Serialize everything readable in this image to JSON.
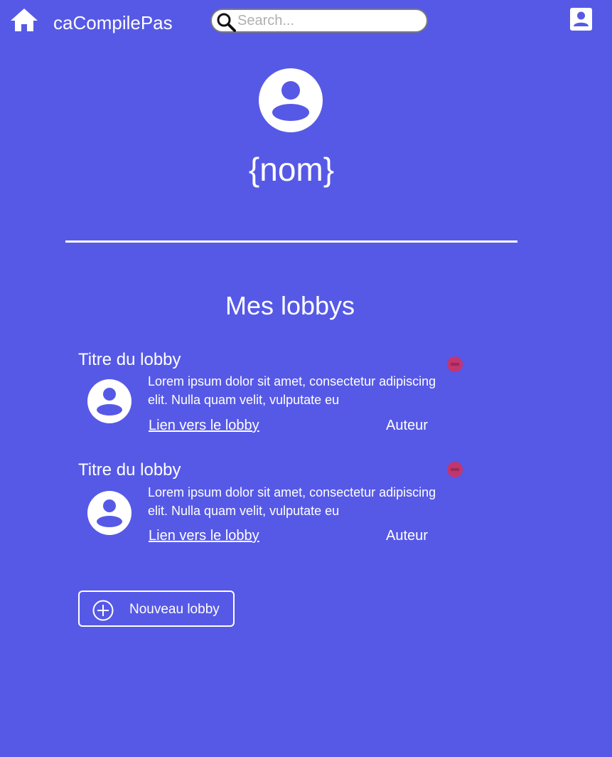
{
  "header": {
    "home_icon": "home-icon",
    "brand": "caCompilePas",
    "search_placeholder": "Search...",
    "search_icon": "search-icon",
    "account_icon": "account-box-icon"
  },
  "profile": {
    "avatar_icon": "account-circle-icon",
    "name": "{nom}"
  },
  "lobbies_section": {
    "title": "Mes lobbys",
    "items": [
      {
        "title": "Titre du lobby",
        "description": "Lorem ipsum dolor sit amet, consectetur adipiscing elit. Nulla quam velit, vulputate eu",
        "link": "Lien vers le lobby",
        "author": "Auteur",
        "remove_icon": "minus-circle-icon"
      },
      {
        "title": "Titre du lobby",
        "description": "Lorem ipsum dolor sit amet, consectetur adipiscing elit. Nulla quam velit, vulputate eu",
        "link": "Lien vers le lobby",
        "author": "Auteur",
        "remove_icon": "minus-circle-icon"
      }
    ],
    "new_button": {
      "label": "Nouveau lobby",
      "icon": "plus-circle-icon"
    }
  },
  "colors": {
    "background": "#5659e6",
    "foreground": "#ffffff",
    "remove_accent": "#c2356f"
  }
}
